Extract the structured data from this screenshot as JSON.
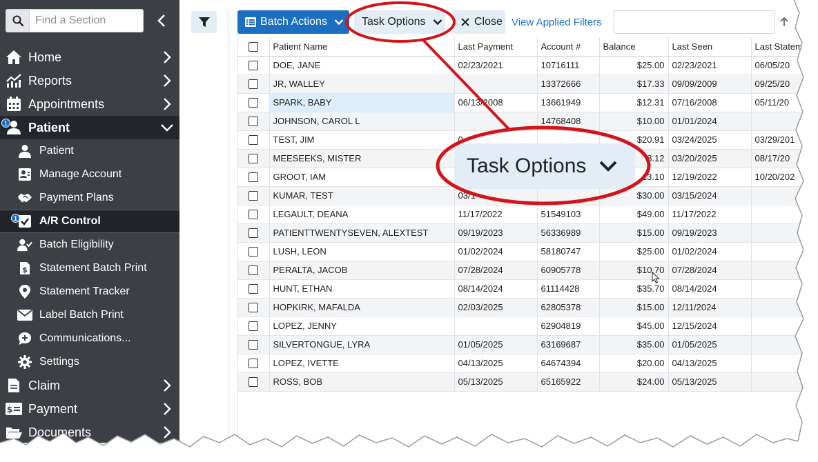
{
  "sidebar": {
    "search_placeholder": "Find a Section",
    "nav": {
      "home": "Home",
      "reports": "Reports",
      "appointments": "Appointments",
      "patient": "Patient",
      "claim": "Claim",
      "payment": "Payment",
      "documents": "Documents"
    },
    "patient_badge": "1",
    "ar_badge": "1",
    "sub_items": {
      "patient": "Patient",
      "manage_account": "Manage Account",
      "payment_plans": "Payment Plans",
      "ar_control": "A/R Control",
      "batch_eligibility": "Batch Eligibility",
      "statement_batch_print": "Statement Batch Print",
      "statement_tracker": "Statement Tracker",
      "label_batch_print": "Label Batch Print",
      "communications": "Communications...",
      "settings": "Settings"
    }
  },
  "toolbar": {
    "batch_actions": "Batch Actions",
    "task_options": "Task Options",
    "close": "Close",
    "view_applied_filters": "View Applied Filters"
  },
  "callout": {
    "label": "Task Options",
    "ring_color": "#d4141b"
  },
  "table": {
    "columns": {
      "patient_name": "Patient Name",
      "last_payment": "Last Payment",
      "account": "Account #",
      "balance": "Balance",
      "last_seen": "Last Seen",
      "last_statement": "Last Statem"
    },
    "rows": [
      {
        "name": "DOE, JANE",
        "last_payment": "02/23/2021",
        "account": "10716111",
        "balance": "$25.00",
        "last_seen": "02/23/2021",
        "last_statement": "06/05/20"
      },
      {
        "name": "JR, WALLEY",
        "last_payment": "",
        "account": "13372666",
        "balance": "$17.33",
        "last_seen": "09/09/2009",
        "last_statement": "09/25/20"
      },
      {
        "name": "SPARK, BABY",
        "last_payment": "06/13/2008",
        "account": "13661949",
        "balance": "$12.31",
        "last_seen": "07/16/2008",
        "last_statement": "05/11/20"
      },
      {
        "name": "JOHNSON, CAROL L",
        "last_payment": "",
        "account": "14768408",
        "balance": "$10.00",
        "last_seen": "01/01/2024",
        "last_statement": ""
      },
      {
        "name": "TEST, JIM",
        "last_payment": "0",
        "account": "",
        "balance": "$20.91",
        "last_seen": "03/24/2025",
        "last_statement": "03/29/201"
      },
      {
        "name": "MEESEEKS, MISTER",
        "last_payment": "",
        "account": "",
        "balance": "8.12",
        "last_seen": "03/20/2025",
        "last_statement": "08/17/20"
      },
      {
        "name": "GROOT, IAM",
        "last_payment": "",
        "account": "",
        "balance": "13.10",
        "last_seen": "12/19/2022",
        "last_statement": "10/20/202"
      },
      {
        "name": "KUMAR, TEST",
        "last_payment": "03/1",
        "account": "",
        "balance": "$30.00",
        "last_seen": "03/15/2024",
        "last_statement": ""
      },
      {
        "name": "LEGAULT, DEANA",
        "last_payment": "11/17/2022",
        "account": "51549103",
        "balance": "$49.00",
        "last_seen": "11/17/2022",
        "last_statement": ""
      },
      {
        "name": "PATIENTTWENTYSEVEN, ALEXTEST",
        "last_payment": "09/19/2023",
        "account": "56336989",
        "balance": "$15.00",
        "last_seen": "09/19/2023",
        "last_statement": ""
      },
      {
        "name": "LUSH, LEON",
        "last_payment": "01/02/2024",
        "account": "58180747",
        "balance": "$25.00",
        "last_seen": "01/02/2024",
        "last_statement": ""
      },
      {
        "name": "PERALTA, JACOB",
        "last_payment": "07/28/2024",
        "account": "60905778",
        "balance": "$10.70",
        "last_seen": "07/28/2024",
        "last_statement": ""
      },
      {
        "name": "HUNT, ETHAN",
        "last_payment": "08/14/2024",
        "account": "61114428",
        "balance": "$35.70",
        "last_seen": "08/14/2024",
        "last_statement": ""
      },
      {
        "name": "HOPKIRK, MAFALDA",
        "last_payment": "02/03/2025",
        "account": "62805378",
        "balance": "$15.00",
        "last_seen": "12/11/2024",
        "last_statement": ""
      },
      {
        "name": "LOPEZ, JENNY",
        "last_payment": "",
        "account": "62904819",
        "balance": "$45.00",
        "last_seen": "12/15/2024",
        "last_statement": ""
      },
      {
        "name": "SILVERTONGUE, LYRA",
        "last_payment": "01/05/2025",
        "account": "63169687",
        "balance": "$35.00",
        "last_seen": "01/05/2025",
        "last_statement": ""
      },
      {
        "name": "LOPEZ, IVETTE",
        "last_payment": "04/13/2025",
        "account": "64674394",
        "balance": "$20.00",
        "last_seen": "04/13/2025",
        "last_statement": ""
      },
      {
        "name": "ROSS, BOB",
        "last_payment": "05/13/2025",
        "account": "65165922",
        "balance": "$24.00",
        "last_seen": "05/13/2025",
        "last_statement": ""
      }
    ]
  },
  "colors": {
    "sidebar_bg": "#3c3f44",
    "sidebar_active": "#23262a",
    "primary": "#1c6fc0",
    "secondary_btn": "#e4ecf5",
    "highlight_cell": "#dceefb"
  }
}
